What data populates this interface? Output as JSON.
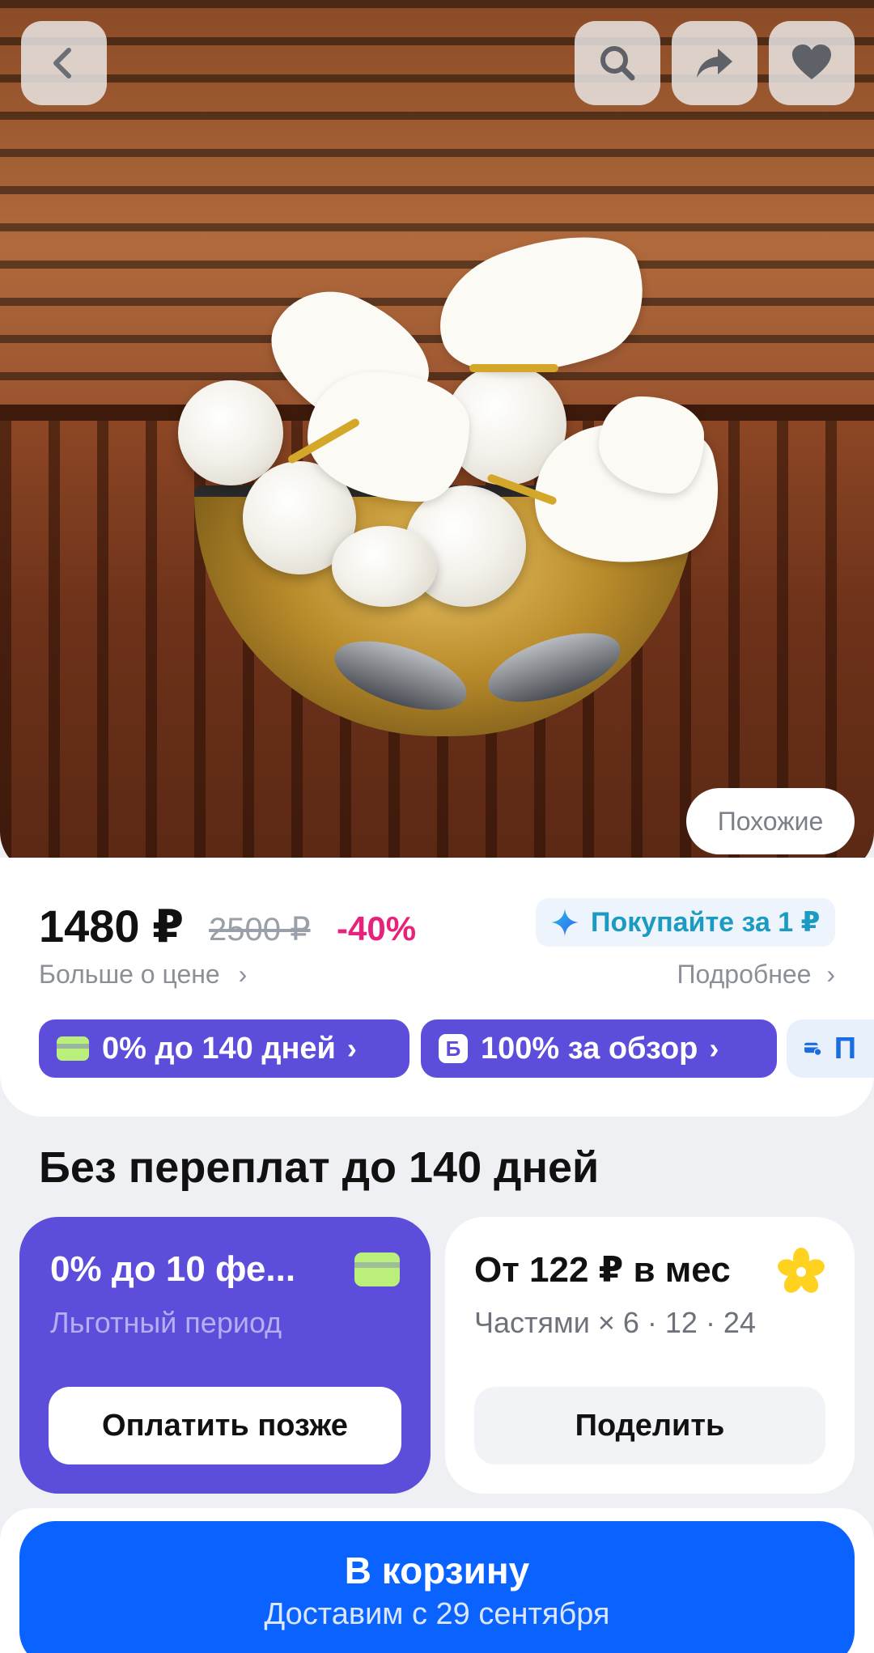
{
  "header": {
    "back_icon": "chevron-left-icon",
    "search_icon": "search-icon",
    "share_icon": "share-arrow-icon",
    "favorite_icon": "heart-icon"
  },
  "photo": {
    "similar_label": "Похожие"
  },
  "price": {
    "current": "1480 ₽",
    "old": "2500 ₽",
    "discount": "-40%",
    "more_about_price": "Больше о цене",
    "buy_for_one": "Покупайте за 1 ₽",
    "details": "Подробнее"
  },
  "chips": [
    {
      "label": "0% до 140 дней",
      "icon": "card-icon"
    },
    {
      "label": "100% за обзор",
      "icon": "b-badge-icon"
    },
    {
      "label": "П",
      "icon": "card-clock-icon"
    }
  ],
  "installments": {
    "title": "Без переплат до 140 дней",
    "grace": {
      "title": "0% до 10 фе...",
      "subtitle": "Льготный период",
      "button": "Оплатить позже"
    },
    "split": {
      "title": "От 122 ₽ в мес",
      "subtitle": "Частями × 6 · 12 · 24",
      "button": "Поделить"
    }
  },
  "cart": {
    "label": "В корзину",
    "delivery": "Доставим с 29 сентября"
  },
  "colors": {
    "accent_violet": "#5c4ddb",
    "cart_blue": "#0a62ff",
    "discount_pink": "#e8227a",
    "promo_teal": "#1b9bc2"
  }
}
